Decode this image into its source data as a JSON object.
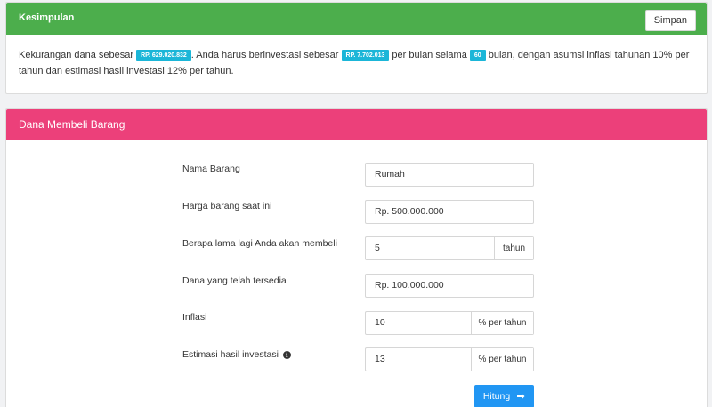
{
  "summary": {
    "title": "Kesimpulan",
    "save_label": "Simpan",
    "text_1": "Kekurangan dana sebesar ",
    "badge_shortfall": "RP. 629.020.832",
    "text_2": ". Anda harus berinvestasi sebesar ",
    "badge_monthly": "RP. 7.702.013",
    "text_3": " per bulan selama ",
    "badge_months": "60",
    "text_4": " bulan, dengan asumsi inflasi tahunan 10% per tahun dan estimasi hasil investasi 12% per tahun."
  },
  "form": {
    "title": "Dana Membeli Barang",
    "item_name": {
      "label": "Nama Barang",
      "value": "Rumah"
    },
    "current_price": {
      "label": "Harga barang saat ini",
      "value": "Rp. 500.000.000"
    },
    "years": {
      "label": "Berapa lama lagi Anda akan membeli",
      "value": "5",
      "unit": "tahun"
    },
    "available_funds": {
      "label": "Dana yang telah tersedia",
      "value": "Rp. 100.000.000"
    },
    "inflation": {
      "label": "Inflasi",
      "value": "10",
      "unit": "% per tahun"
    },
    "investment_return": {
      "label": "Estimasi hasil investasi",
      "value": "13",
      "unit": "% per tahun"
    },
    "calculate_label": "Hitung"
  },
  "icons": {
    "info": "info-circle-icon",
    "calculate": "arrow-right-icon"
  },
  "colors": {
    "summary_header": "#4cae4c",
    "form_header": "#ec407a",
    "badge": "#1bb6d8",
    "primary_button": "#2196f3"
  }
}
